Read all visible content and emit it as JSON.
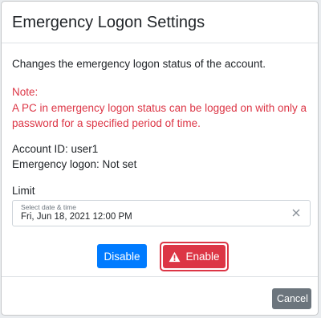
{
  "dialog": {
    "title": "Emergency Logon Settings",
    "description": "Changes the emergency logon status of the account.",
    "note_heading": "Note:",
    "note_text": "A PC in emergency logon status can be logged on with only a password for a specified period of time.",
    "account_id": "Account ID: user1",
    "emergency_logon": "Emergency logon: Not set",
    "limit_label": "Limit",
    "date_field": {
      "placeholder": "Select date & time",
      "value": "Fri, Jun 18, 2021 12:00 PM"
    },
    "disable_label": "Disable",
    "enable_label": "Enable",
    "cancel_label": "Cancel"
  },
  "icons": {
    "clear": "close-icon",
    "enable": "warning-icon"
  },
  "colors": {
    "primary": "#007bff",
    "danger": "#dc3545",
    "secondary": "#6c757d"
  }
}
